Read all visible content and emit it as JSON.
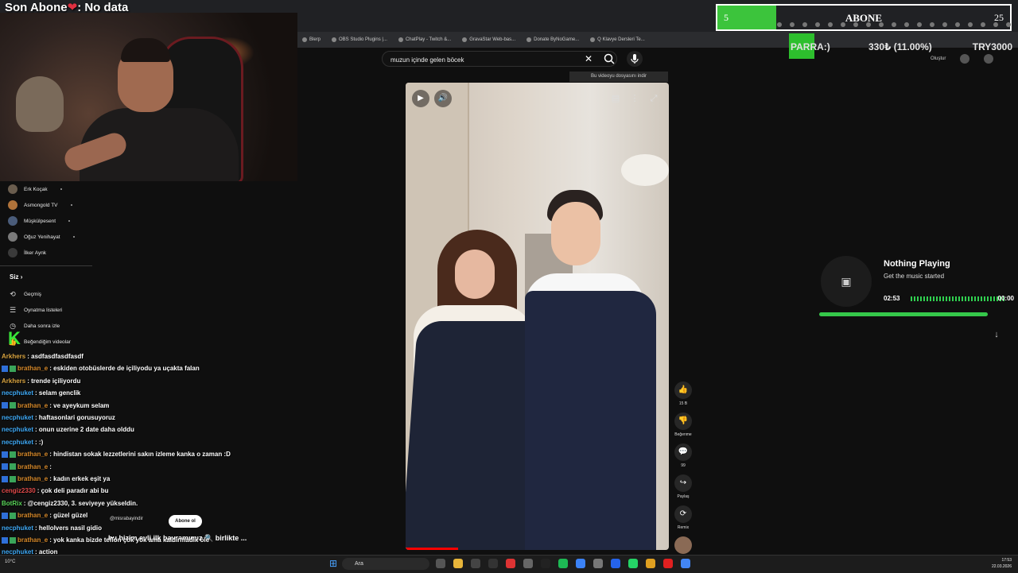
{
  "overlay": {
    "sub_text_left": "Son Abone",
    "sub_heart": "❤",
    "sub_text_right": ": No data"
  },
  "abone": {
    "label": "ABONE",
    "current": "5",
    "goal": "25",
    "progress": 0.2
  },
  "bits": {
    "label": "PARRA:)",
    "amount": "330₺ (11.00%)",
    "goal": "TRY3000",
    "progress": 0.11
  },
  "bookmarks": [
    "Blerp",
    "OBS Studio Plugins |...",
    "ChatPlay - Twitch &...",
    "GravaStar Web-bas...",
    "Donate ByNoGame...",
    "Q Klavye Dersleri Te..."
  ],
  "search": {
    "value": "muzun içinde gelen böcek",
    "clear": "✕"
  },
  "download_note": "Bu videoyu dosyasını indir",
  "upload_label": "Oluştur",
  "actions": [
    {
      "icon": "👍",
      "label": "15 B"
    },
    {
      "icon": "👎",
      "label": "Beğenme"
    },
    {
      "icon": "💬",
      "label": "99"
    },
    {
      "icon": "↪",
      "label": "Paylaş"
    },
    {
      "icon": "⟳",
      "label": "Remix"
    }
  ],
  "video": {
    "progress": 0.2
  },
  "short": {
    "channel": "@misrabayindir",
    "subscribe": "Abone ol",
    "caption": "bu bizim evli ilk bayramımız 🔍 birlikte ..."
  },
  "sidebar": {
    "subscriptions": [
      "Erk Koçak",
      "Asmongold TV",
      "Müşkülpesent",
      "Oğuz Yenihayat",
      "İlker Aynk"
    ],
    "siz_label": "Siz",
    "siz_chevron": "›",
    "siz_items": [
      {
        "icon": "⟲",
        "label": "Geçmiş"
      },
      {
        "icon": "☰",
        "label": "Oynatma listeleri"
      },
      {
        "icon": "◷",
        "label": "Daha sonra izle"
      },
      {
        "icon": "👍",
        "label": "Beğendiğim videolar"
      }
    ]
  },
  "chat": [
    {
      "user": "Arkhers",
      "text": "asdfasdfasdfasdf",
      "color": "#d9a441",
      "badges": false
    },
    {
      "user": "brathan_e",
      "text": "eskiden otobüslerde de içiliyodu ya uçakta falan",
      "color": "#d88a2a",
      "badges": true
    },
    {
      "user": "Arkhers",
      "text": "trende içiliyordu",
      "color": "#d9a441",
      "badges": false
    },
    {
      "user": "necphuket",
      "text": "selam genclik",
      "color": "#3fa9f5",
      "badges": false
    },
    {
      "user": "brathan_e",
      "text": "ve ayeykum selam",
      "color": "#d88a2a",
      "badges": true
    },
    {
      "user": "necphuket",
      "text": "haftasonlari gorusuyoruz",
      "color": "#3fa9f5",
      "badges": false
    },
    {
      "user": "necphuket",
      "text": "onun uzerine 2 date daha olddu",
      "color": "#3fa9f5",
      "badges": false
    },
    {
      "user": "necphuket",
      "text": ":)",
      "color": "#3fa9f5",
      "badges": false
    },
    {
      "user": "brathan_e",
      "text": "hindistan sokak lezzetlerini sakın izleme kanka o zaman :D",
      "color": "#d88a2a",
      "badges": true
    },
    {
      "user": "brathan_e",
      "text": "",
      "color": "#d88a2a",
      "badges": true
    },
    {
      "user": "brathan_e",
      "text": "kadın erkek eşit ya",
      "color": "#d88a2a",
      "badges": true
    },
    {
      "user": "cengiz2330",
      "text": "çok deli paradır abi bu",
      "color": "#e24a4a",
      "badges": false
    },
    {
      "user": "BotRix",
      "text": "@cengiz2330, 3. seviyeye yükseldin.",
      "color": "#5ad65a",
      "badges": false
    },
    {
      "user": "brathan_e",
      "text": "güzel güzel",
      "color": "#d88a2a",
      "badges": true
    },
    {
      "user": "necphuket",
      "text": "hellolvers nasil gidio",
      "color": "#3fa9f5",
      "badges": false
    },
    {
      "user": "brathan_e",
      "text": "yok kanka bizde teflon çok yok ama kaldırmadık öle",
      "color": "#d88a2a",
      "badges": true
    },
    {
      "user": "necphuket",
      "text": "action",
      "color": "#3fa9f5",
      "badges": false
    }
  ],
  "music": {
    "title": "Nothing Playing",
    "subtitle": "Get the music started",
    "elapsed": "02:53",
    "remaining": "00:00",
    "progress": 1.0
  },
  "taskbar": {
    "search": "Ara",
    "weather": "10°C",
    "time": "17:53",
    "date": "22.03.2026"
  }
}
